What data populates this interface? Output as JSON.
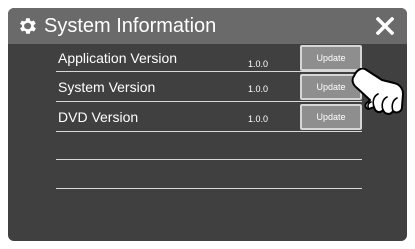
{
  "window": {
    "title": "System Information",
    "title_icon": "gear-icon",
    "close_label": "X"
  },
  "rows": [
    {
      "label": "Application Version",
      "value": "1.0.0",
      "button": "Update"
    },
    {
      "label": "System Version",
      "value": "1.0.0",
      "button": "Update"
    },
    {
      "label": "DVD Version",
      "value": "1.0.0",
      "button": "Update"
    }
  ],
  "colors": {
    "titlebar": "#6a6a6a",
    "panel": "#404040",
    "button": "#8e8e8e",
    "text": "#ffffff"
  },
  "illustration": {
    "type": "pointing-hand-icon",
    "target": "rows.1.button"
  }
}
